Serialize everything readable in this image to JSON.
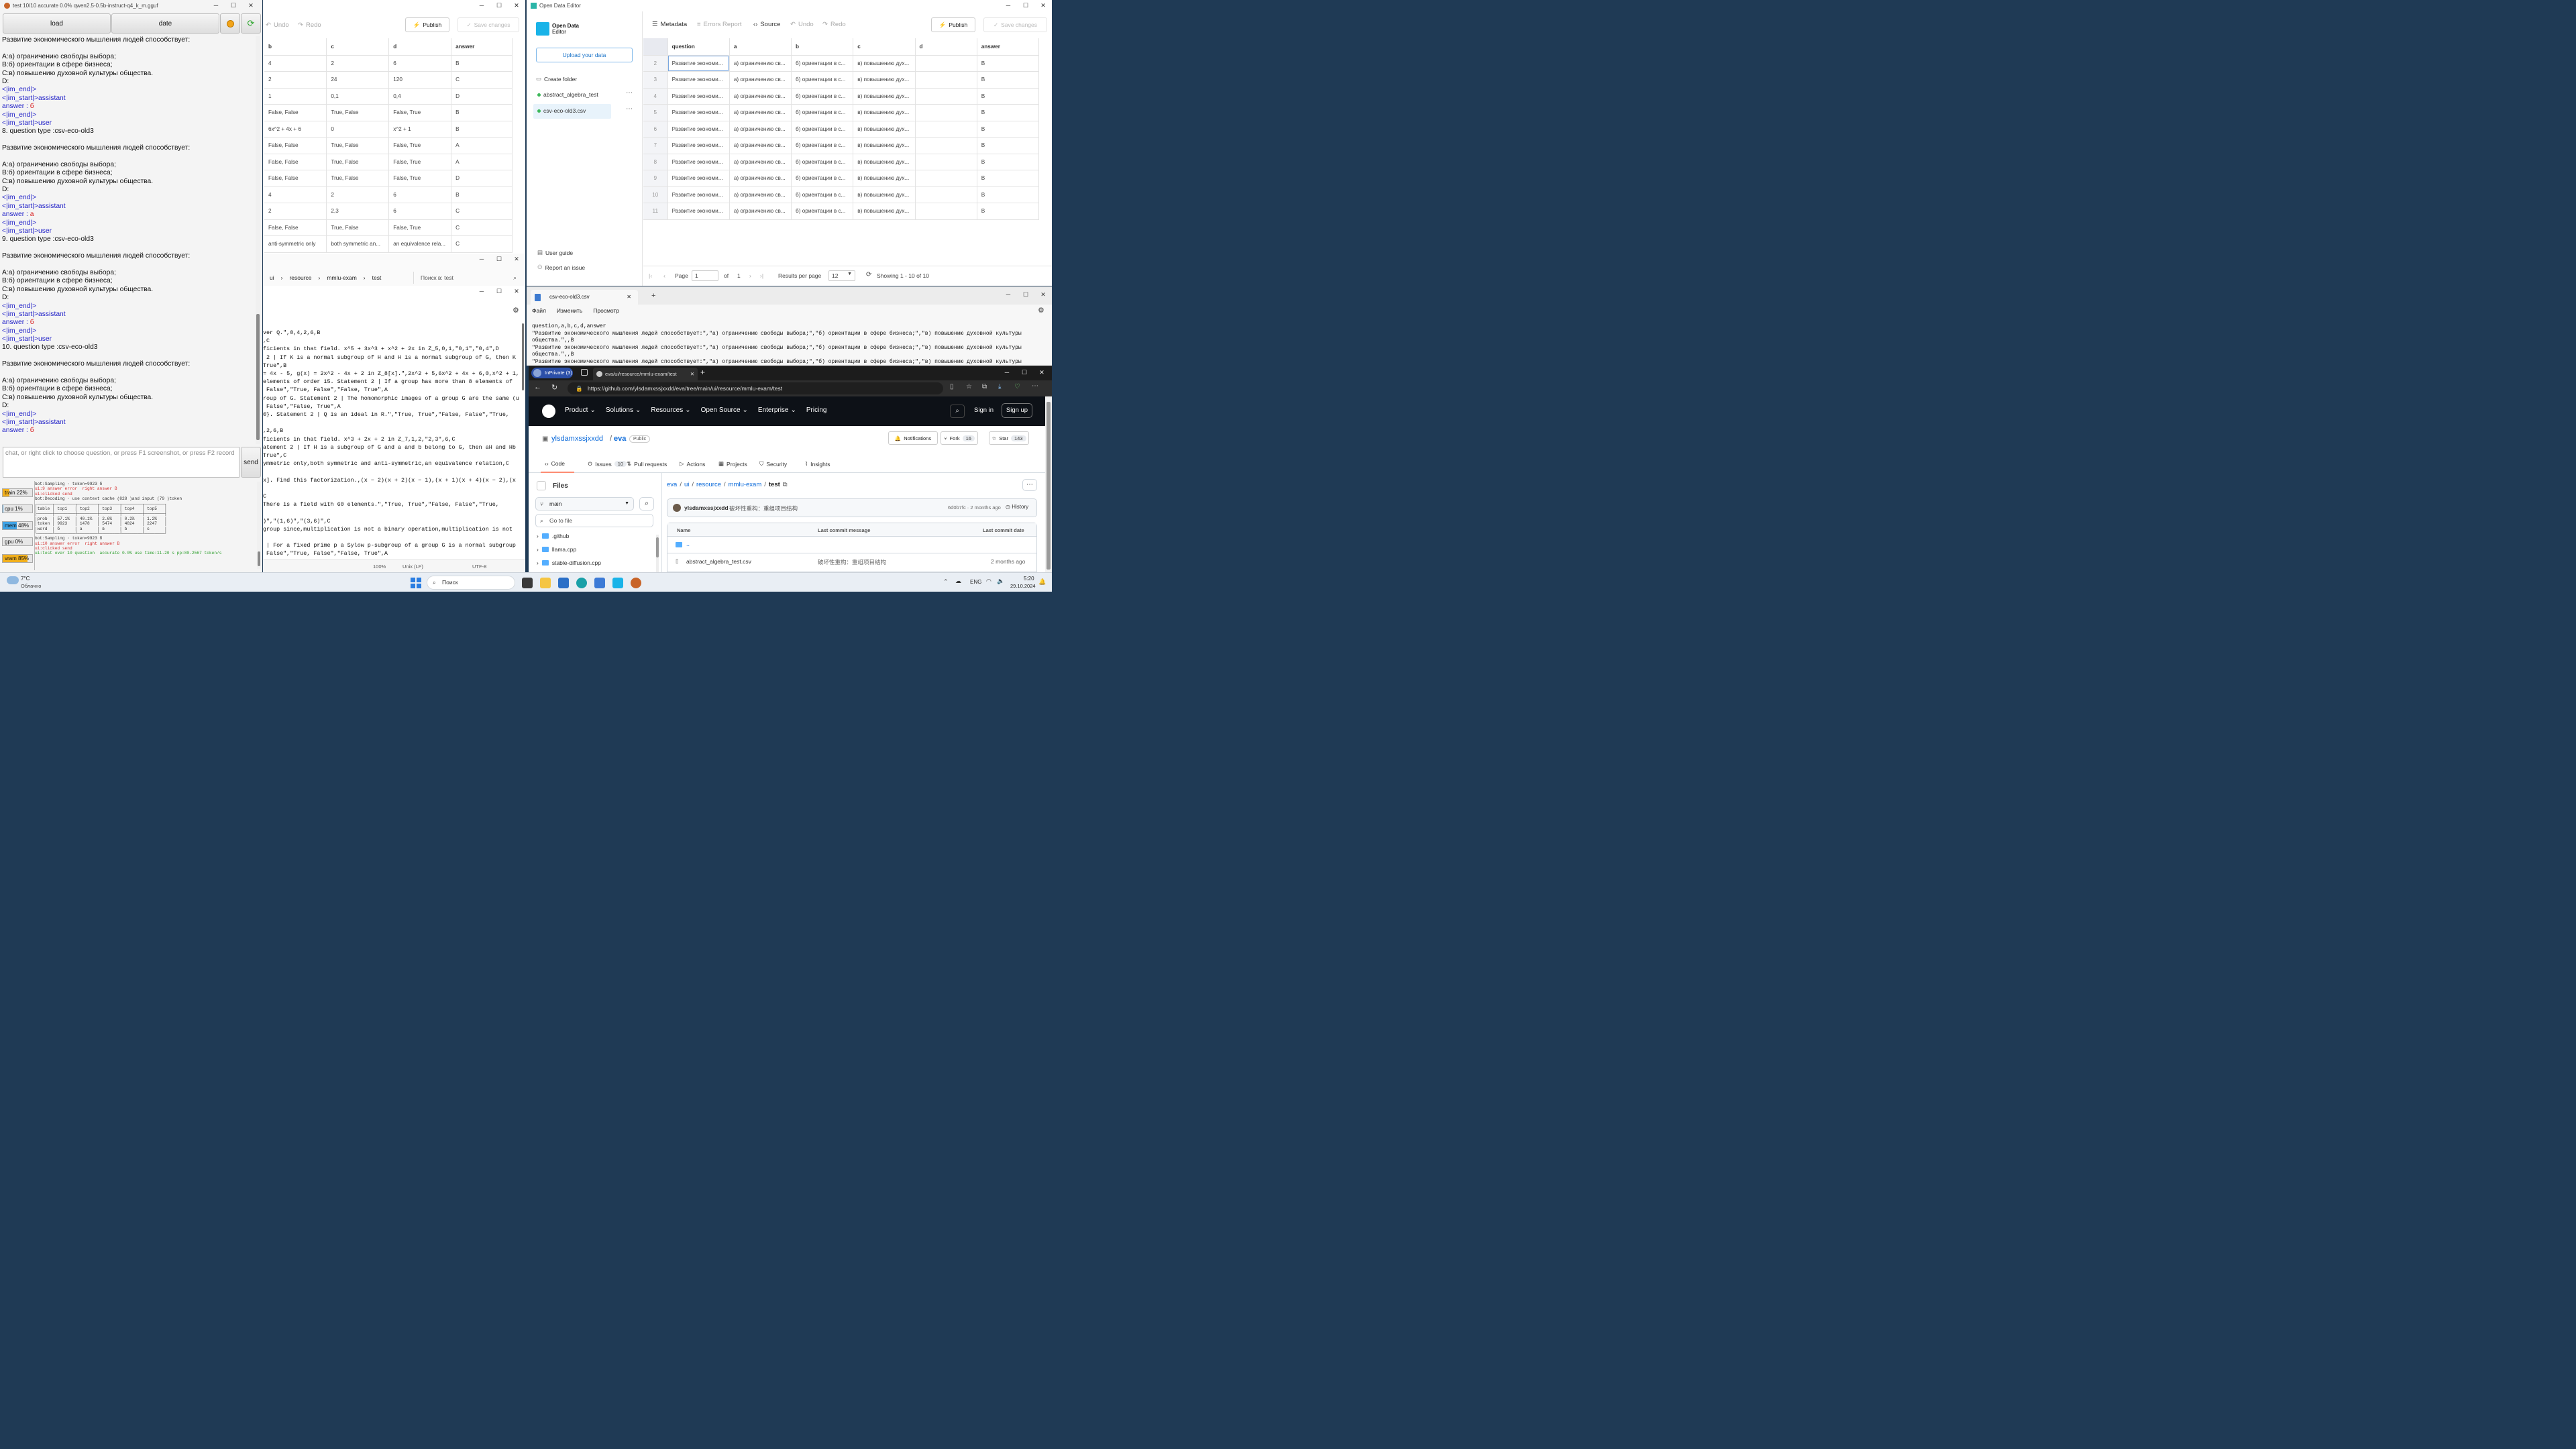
{
  "llm_app": {
    "title": "test 10/10   accurate 0.0%   qwen2.5-0.5b-instruct-q4_k_m.gguf",
    "load_label": "load",
    "date_label": "date",
    "chat_lines": [
      {
        "t": "Развитие экономического мышления людей способствует:",
        "c": "n"
      },
      {
        "t": "",
        "c": "n"
      },
      {
        "t": "A:а) ограничению свободы выбора;",
        "c": "n"
      },
      {
        "t": "B:б) ориентации в сфере бизнеса;",
        "c": "n"
      },
      {
        "t": "C:в) повышению духовной культуры общества.",
        "c": "n"
      },
      {
        "t": "D:",
        "c": "n"
      },
      {
        "t": "<|im_end|>",
        "c": "tk"
      },
      {
        "t": "<|im_start|>assistant",
        "c": "tk"
      },
      {
        "t": "answer : ",
        "v": "б",
        "c": "an"
      },
      {
        "t": "<|im_end|>",
        "c": "tk"
      },
      {
        "t": "<|im_start|>user",
        "c": "tk"
      },
      {
        "t": "8. question type :csv-eco-old3",
        "c": "n"
      },
      {
        "t": "",
        "c": "n"
      },
      {
        "t": "Развитие экономического мышления людей способствует:",
        "c": "n"
      },
      {
        "t": "",
        "c": "n"
      },
      {
        "t": "A:а) ограничению свободы выбора;",
        "c": "n"
      },
      {
        "t": "B:б) ориентации в сфере бизнеса;",
        "c": "n"
      },
      {
        "t": "C:в) повышению духовной культуры общества.",
        "c": "n"
      },
      {
        "t": "D:",
        "c": "n"
      },
      {
        "t": "<|im_end|>",
        "c": "tk"
      },
      {
        "t": "<|im_start|>assistant",
        "c": "tk"
      },
      {
        "t": "answer : ",
        "v": "а",
        "c": "an"
      },
      {
        "t": "<|im_end|>",
        "c": "tk"
      },
      {
        "t": "<|im_start|>user",
        "c": "tk"
      },
      {
        "t": "9. question type :csv-eco-old3",
        "c": "n"
      },
      {
        "t": "",
        "c": "n"
      },
      {
        "t": "Развитие экономического мышления людей способствует:",
        "c": "n"
      },
      {
        "t": "",
        "c": "n"
      },
      {
        "t": "A:а) ограничению свободы выбора;",
        "c": "n"
      },
      {
        "t": "B:б) ориентации в сфере бизнеса;",
        "c": "n"
      },
      {
        "t": "C:в) повышению духовной культуры общества.",
        "c": "n"
      },
      {
        "t": "D:",
        "c": "n"
      },
      {
        "t": "<|im_end|>",
        "c": "tk"
      },
      {
        "t": "<|im_start|>assistant",
        "c": "tk"
      },
      {
        "t": "answer : ",
        "v": "б",
        "c": "an"
      },
      {
        "t": "<|im_end|>",
        "c": "tk"
      },
      {
        "t": "<|im_start|>user",
        "c": "tk"
      },
      {
        "t": "10. question type :csv-eco-old3",
        "c": "n"
      },
      {
        "t": "",
        "c": "n"
      },
      {
        "t": "Развитие экономического мышления людей способствует:",
        "c": "n"
      },
      {
        "t": "",
        "c": "n"
      },
      {
        "t": "A:а) ограничению свободы выбора;",
        "c": "n"
      },
      {
        "t": "B:б) ориентации в сфере бизнеса;",
        "c": "n"
      },
      {
        "t": "C:в) повышению духовной культуры общества.",
        "c": "n"
      },
      {
        "t": "D:",
        "c": "n"
      },
      {
        "t": "<|im_end|>",
        "c": "tk"
      },
      {
        "t": "<|im_start|>assistant",
        "c": "tk"
      },
      {
        "t": "answer : ",
        "v": "б",
        "c": "an"
      }
    ],
    "input_placeholder": "chat, or right click to choose question, or press F1 screenshot, or press F2 record",
    "send_label": "send",
    "stats": [
      {
        "label": "train 22%",
        "pct": 22,
        "color": "#f2b01c"
      },
      {
        "label": "cpu 1%",
        "pct": 1,
        "color": "#3fa3e6"
      },
      {
        "label": "mem 48%",
        "pct": 48,
        "color": "#3fa3e6"
      },
      {
        "label": "gpu 0%",
        "pct": 0,
        "color": "#3fa3e6"
      },
      {
        "label": "vram 85%",
        "pct": 85,
        "color": "#f2b01c"
      }
    ],
    "log_lines": [
      {
        "t": "bot:Sampling · token=9923 б",
        "c": ""
      },
      {
        "t": "ui:9 answer error  right answer B",
        "c": "red"
      },
      {
        "t": "ui:clicked send",
        "c": "red"
      },
      {
        "t": "bot:Decoding · use context cache (828 )and input (79 )token",
        "c": ""
      },
      {
        "t": "┌──────┬────────┬────────┬────────┬────────┬────────┐",
        "c": ""
      },
      {
        "t": "│table │ top1   │ top2   │ top3   │ top4   │ top5   │",
        "c": ""
      },
      {
        "t": "├──────┼────────┼────────┼────────┼────────┼────────┤",
        "c": ""
      },
      {
        "t": "│prob  │ 57.1%  │ 40.1%  │ 2.6%   │ 0.2%   │ 1.2%   │",
        "c": ""
      },
      {
        "t": "│token │ 9923   │ 1478   │ 5474   │ 4824   │ 2247   │",
        "c": ""
      },
      {
        "t": "│word  │ б      │ а      │ в      │ b      │ c      │",
        "c": ""
      },
      {
        "t": "└──────┴────────┴────────┴────────┴────────┴────────┘",
        "c": ""
      },
      {
        "t": "bot:Sampling · token=9923 б",
        "c": ""
      },
      {
        "t": "ui:10 answer error  right answer B",
        "c": "red"
      },
      {
        "t": "ui:clicked send",
        "c": "red"
      },
      {
        "t": "ui:test over 10 question  accurate 0.0% use time:11.20 s pp:80.2567 token/s",
        "c": "grn"
      }
    ]
  },
  "csv_left": {
    "toolbar": {
      "undo": "Undo",
      "redo": "Redo",
      "publish": "Publish",
      "save": "Save changes"
    },
    "headers": [
      "b",
      "c",
      "d",
      "answer"
    ],
    "rows": [
      [
        "4",
        "2",
        "6",
        "B"
      ],
      [
        "2",
        "24",
        "120",
        "C"
      ],
      [
        "1",
        "0,1",
        "0,4",
        "D"
      ],
      [
        "False, False",
        "True, False",
        "False, True",
        "B"
      ],
      [
        "6x^2 + 4x + 6",
        "0",
        "x^2 + 1",
        "B"
      ],
      [
        "False, False",
        "True, False",
        "False, True",
        "A"
      ],
      [
        "False, False",
        "True, False",
        "False, True",
        "A"
      ],
      [
        "False, False",
        "True, False",
        "False, True",
        "D"
      ],
      [
        "4",
        "2",
        "6",
        "B"
      ],
      [
        "2",
        "2,3",
        "6",
        "C"
      ],
      [
        "False, False",
        "True, False",
        "False, True",
        "C"
      ],
      [
        "anti-symmetric only",
        "both symmetric an...",
        "an equivalence rela...",
        "C"
      ]
    ]
  },
  "explorer": {
    "crumbs": [
      "ui",
      "resource",
      "mmlu-exam",
      "test"
    ],
    "search_placeholder": "Поиск в: test"
  },
  "ode": {
    "title": "Open Data Editor",
    "brand1": "Open Data",
    "brand2": "Editor",
    "upload": "Upload your data",
    "create_folder": "Create folder",
    "files": [
      "abstract_algebra_test",
      "csv-eco-old3.csv"
    ],
    "user_guide": "User guide",
    "report_issue": "Report an issue",
    "tabs": {
      "metadata": "Metadata",
      "errors": "Errors Report",
      "source": "Source",
      "undo": "Undo",
      "redo": "Redo"
    },
    "publish": "Publish",
    "save": "Save changes",
    "headers": [
      "question",
      "a",
      "b",
      "c",
      "d",
      "answer"
    ],
    "row_nums": [
      "2",
      "3",
      "4",
      "5",
      "6",
      "7",
      "8",
      "9",
      "10",
      "11"
    ],
    "row": [
      "Развитие экономи...",
      "а) ограничению св...",
      "б) ориентации в с...",
      "в) повышению дух...",
      "",
      "B"
    ],
    "page_label": "Page",
    "page_value": "1",
    "of_label": "of",
    "of_value": "1",
    "rpp_label": "Results per page",
    "rpp_value": "12",
    "showing": "Showing 1 - 10 of 10"
  },
  "text_left": {
    "lines": [
      "ver Q.\",0,4,2,6,B",
      ",C",
      "ficients in that field. x^5 + 3x^3 + x^2 + 2x in Z_5,0,1,\"0,1\",\"0,4\",D",
      " 2 | If K is a normal subgroup of H and H is a normal subgroup of G, then K",
      "True\",B",
      "= 4x - 5, g(x) = 2x^2 - 4x + 2 in Z_8[x].\",2x^2 + 5,6x^2 + 4x + 6,0,x^2 + 1,B",
      "elements of order 15. Statement 2 | If a group has more than 8 elements of",
      " False\",\"True, False\",\"False, True\",A",
      "roup of G. Statement 2 | The homomorphic images of a group G are the same (up",
      " False\",\"False, True\",A",
      "0}. Statement 2 | Q is an ideal in R.\",\"True, True\",\"False, False\",\"True,",
      "",
      ",2,6,B",
      "ficients in that field. x^3 + 2x + 2 in Z_7,1,2,\"2,3\",6,C",
      "atement 2 | If H is a subgroup of G and a and b belong to G, then aH and Hb",
      "True\",C",
      "ymmetric only,both symmetric and anti-symmetric,an equivalence relation,C",
      "",
      "x]. Find this factorization.,(x − 2)(x + 2)(x − 1),(x + 1)(x + 4)(x − 2),(x",
      "",
      "C",
      "There is a field with 60 elements.\",\"True, True\",\"False, False\",\"True,",
      "",
      ")\",\"(1,6)\",\"(3,6)\",C",
      "group since,multiplication is not a binary operation,multiplication is not",
      "",
      " | For a fixed prime p a Sylow p-subgroup of a group G is a normal subgroup",
      " False\",\"True, False\",\"False, True\",A",
      "rnal direct product.) Statement 2 | If r divides m and s divides n then Z_m +",
      ", False\",\"False, True\",A",
      " - 5, g(x) = 2x^2 - 4x + 2 in Z_8[x].\",2x^2 + 5,6x^2 + 4x + 6,0,x^2 + 1,A",
      "t 2 | If V = span(v1, ... , vk) and {v1, ... , vk} are linearly independent,"
    ],
    "status": [
      "100%",
      "Unix (LF)",
      "UTF-8"
    ]
  },
  "notepad": {
    "tab": "csv-eco-old3.csv",
    "menu": [
      "Файл",
      "Изменить",
      "Просмотр"
    ],
    "lines": [
      "question,a,b,c,d,answer",
      "\"Развитие экономического мышления людей способствует:\",\"а) ограничению свободы выбора;\",\"б) ориентации в сфере бизнеса;\",\"в) повышению духовной культуры",
      "общества.\",,B",
      "\"Развитие экономического мышления людей способствует:\",\"а) ограничению свободы выбора;\",\"б) ориентации в сфере бизнеса;\",\"в) повышению духовной культуры",
      "общества.\",,B",
      "\"Развитие экономического мышления людей способствует:\",\"а) ограничению свободы выбора;\",\"б) ориентации в сфере бизнеса;\",\"в) повышению духовной культуры"
    ]
  },
  "browser": {
    "inprivate": "InPrivate (3)",
    "tab": "eva/ui/resource/mmlu-exam/test",
    "url": "https://github.com/ylsdamxssjxxdd/eva/tree/main/ui/resource/mmlu-exam/test",
    "nav": [
      "Product",
      "Solutions",
      "Resources",
      "Open Source",
      "Enterprise",
      "Pricing"
    ],
    "signin": "Sign in",
    "signup": "Sign up",
    "owner": "ylsdamxssjxxdd",
    "repo": "eva",
    "public": "Public",
    "notifications": "Notifications",
    "fork": "Fork",
    "fork_count": "16",
    "star": "Star",
    "star_count": "143",
    "tabs": [
      {
        "label": "Code"
      },
      {
        "label": "Issues",
        "count": "10"
      },
      {
        "label": "Pull requests"
      },
      {
        "label": "Actions"
      },
      {
        "label": "Projects"
      },
      {
        "label": "Security"
      },
      {
        "label": "Insights"
      }
    ],
    "files_title": "Files",
    "branch": "main",
    "go_to_file": "Go to file",
    "tree": [
      ".github",
      "llama.cpp",
      "stable-diffusion.cpp"
    ],
    "crumbs": [
      "eva",
      "ui",
      "resource",
      "mmlu-exam",
      "test"
    ],
    "commit_user": "ylsdamxssjxxdd",
    "commit_msg": "破坏性重构：重组项目结构",
    "commit_meta": "6d0b7fc · 2 months ago",
    "history": "History",
    "col_name": "Name",
    "col_msg": "Last commit message",
    "col_date": "Last commit date",
    "parent": "..",
    "file_row": {
      "name": "abstract_algebra_test.csv",
      "msg": "破坏性重构：重组项目结构",
      "date": "2 months ago"
    }
  },
  "taskbar": {
    "temp": "7°C",
    "weather": "Облачно",
    "search": "Поиск",
    "lang": "ENG",
    "time": "5:20",
    "date": "29.10.2024"
  }
}
